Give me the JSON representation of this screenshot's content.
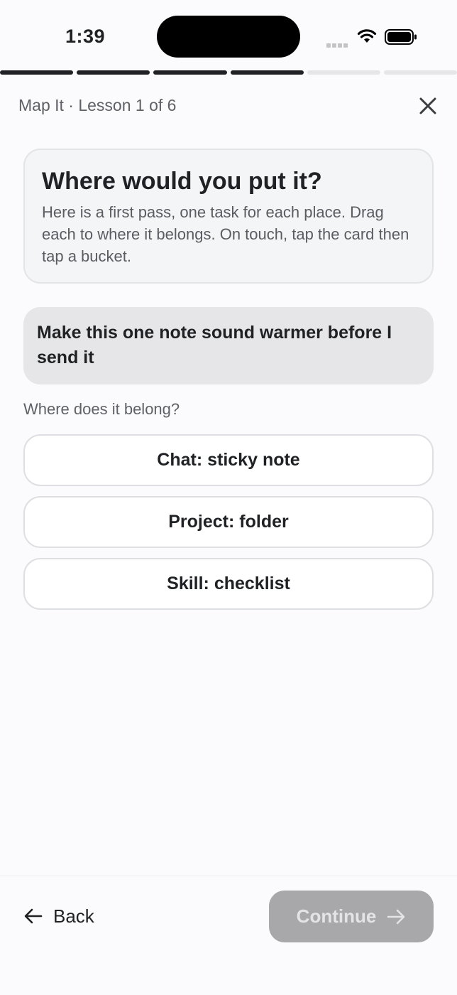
{
  "status": {
    "time": "1:39"
  },
  "progress": {
    "total_steps": 6,
    "completed_steps": 4
  },
  "header": {
    "lesson_label": "Map It · Lesson 1 of 6"
  },
  "intro": {
    "title": "Where would you put it?",
    "body": "Here is a first pass, one task for each place. Drag each to where it belongs. On touch, tap the card then tap a bucket."
  },
  "task": {
    "text": "Make this one note sound warmer before I send it"
  },
  "prompt": "Where does it belong?",
  "buckets": [
    {
      "label": "Chat: sticky note"
    },
    {
      "label": "Project: folder"
    },
    {
      "label": "Skill: checklist"
    }
  ],
  "footer": {
    "back_label": "Back",
    "continue_label": "Continue"
  }
}
